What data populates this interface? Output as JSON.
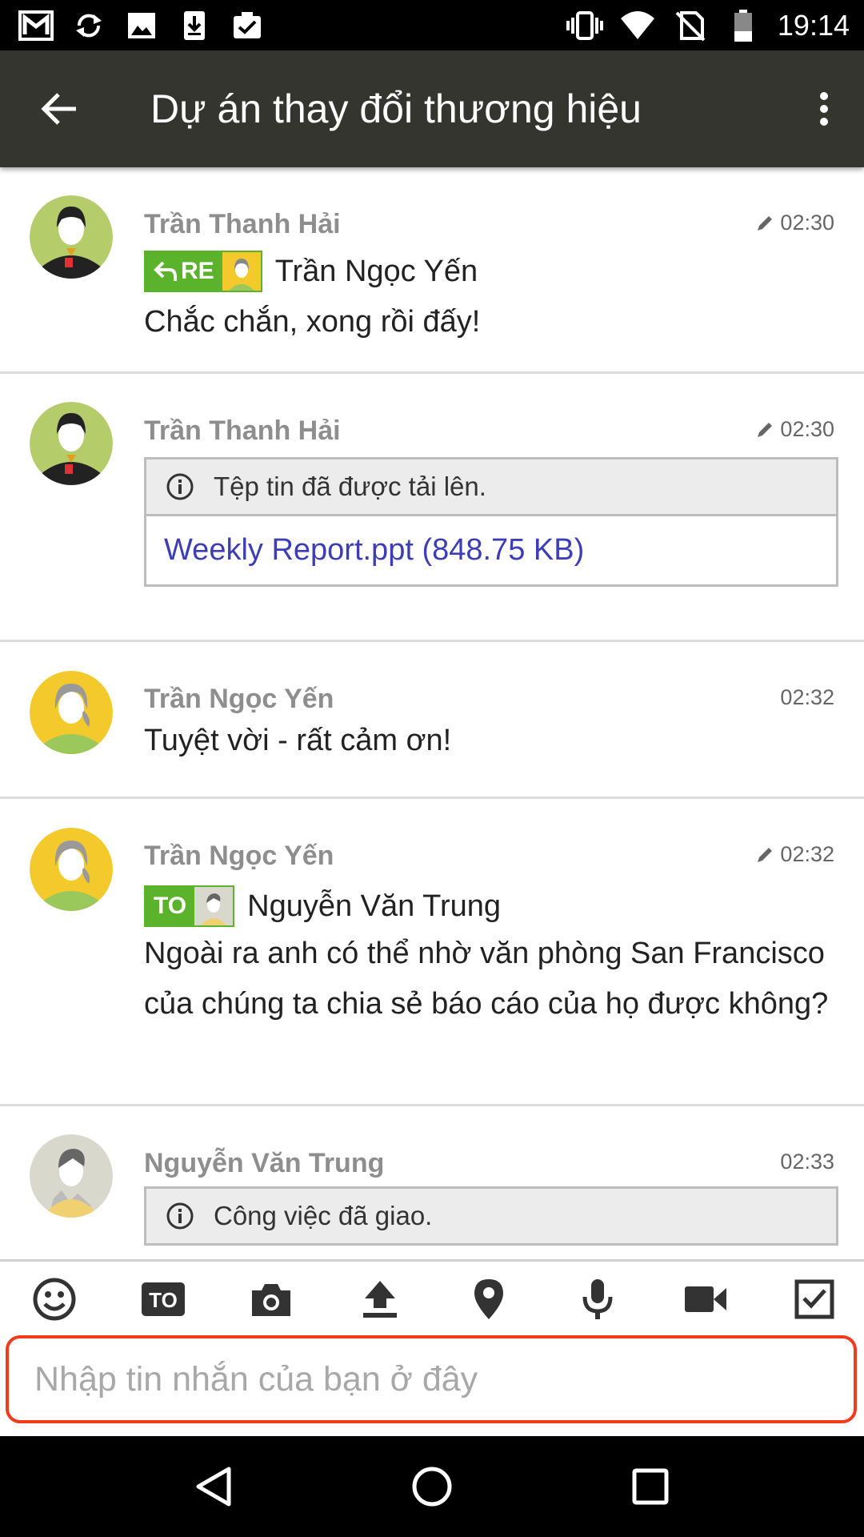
{
  "status_bar": {
    "time": "19:14",
    "left_icons": [
      "gmail-icon",
      "sync-icon",
      "image-icon",
      "download-icon",
      "clipboard-check-icon"
    ],
    "right_icons": [
      "vibrate-icon",
      "wifi-icon",
      "no-sim-icon",
      "battery-icon"
    ]
  },
  "app_bar": {
    "title": "Dự án thay đổi thương hiệu",
    "back_icon": "arrow-back-icon",
    "menu_icon": "more-vert-icon"
  },
  "messages": [
    {
      "sender": "Trần Thanh Hải",
      "time": "02:30",
      "edited": true,
      "tag": "RE",
      "tag_target": "Trần Ngọc Yến",
      "text": "Chắc chắn, xong rồi đấy!"
    },
    {
      "sender": "Trần Thanh Hải",
      "time": "02:30",
      "edited": true,
      "info": "Tệp tin đã được tải lên.",
      "file": "Weekly Report.ppt (848.75 KB)"
    },
    {
      "sender": "Trần Ngọc Yến",
      "time": "02:32",
      "text": "Tuyệt vời - rất cảm ơn!"
    },
    {
      "sender": "Trần Ngọc Yến",
      "time": "02:32",
      "edited": true,
      "tag": "TO",
      "tag_target": "Nguyễn Văn Trung",
      "text": "Ngoài ra anh có thể nhờ văn phòng San Francisco của chúng ta chia sẻ báo cáo của họ được không?"
    },
    {
      "sender": "Nguyễn Văn Trung",
      "time": "02:33",
      "info": "Công việc đã giao."
    }
  ],
  "toolbar": {
    "items": [
      "emoji-icon",
      "to-icon",
      "camera-icon",
      "upload-icon",
      "location-icon",
      "mic-icon",
      "video-icon",
      "task-icon"
    ],
    "to_label": "TO"
  },
  "input": {
    "placeholder": "Nhập tin nhắn của bạn ở đây",
    "value": ""
  },
  "nav_bar": {
    "items": [
      "back-triangle-icon",
      "home-circle-icon",
      "recents-square-icon"
    ]
  },
  "colors": {
    "app_bar": "#34352f",
    "tag_green": "#5bb22b",
    "link": "#3d3eb5",
    "input_border": "#f23b1c"
  }
}
